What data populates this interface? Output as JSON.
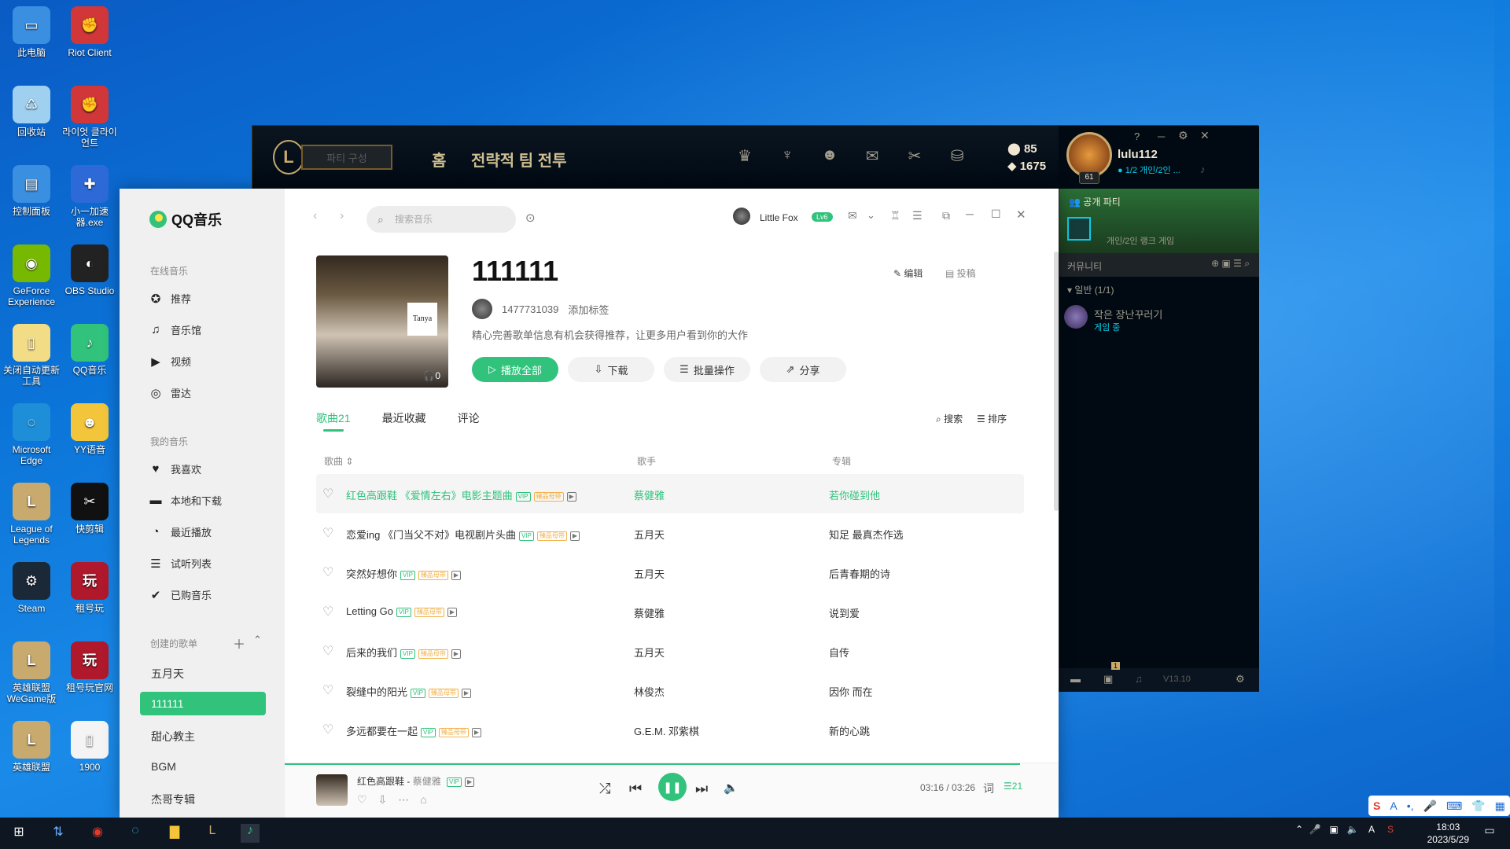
{
  "desktop": {
    "icons": [
      {
        "label": "此电脑",
        "color": "#3b8fe0",
        "glyph": "▭"
      },
      {
        "label": "Riot Client",
        "color": "#d13639",
        "glyph": "✊"
      },
      {
        "label": "回收站",
        "color": "#9fd0f0",
        "glyph": "♺"
      },
      {
        "label": "라이엇 클라이언트",
        "color": "#d13639",
        "glyph": "✊"
      },
      {
        "label": "控制面板",
        "color": "#3b8fe0",
        "glyph": "▤"
      },
      {
        "label": "小一加速器.exe",
        "color": "#2d6ad8",
        "glyph": "✚"
      },
      {
        "label": "GeForce Experience",
        "color": "#76b900",
        "glyph": "◉"
      },
      {
        "label": "OBS Studio",
        "color": "#222",
        "glyph": "◐"
      },
      {
        "label": "关闭自动更新工具",
        "color": "#f3dc86",
        "glyph": "▯"
      },
      {
        "label": "QQ音乐",
        "color": "#31c27c",
        "glyph": "♪"
      },
      {
        "label": "Microsoft Edge",
        "color": "#1e8ed8",
        "glyph": "◌"
      },
      {
        "label": "YY语音",
        "color": "#f3c53a",
        "glyph": "☻"
      },
      {
        "label": "League of Legends",
        "color": "#c8aa6e",
        "glyph": "L"
      },
      {
        "label": "快剪辑",
        "color": "#111",
        "glyph": "✂"
      },
      {
        "label": "Steam",
        "color": "#1b2838",
        "glyph": "⚙"
      },
      {
        "label": "租号玩",
        "color": "#b0182b",
        "glyph": "玩"
      },
      {
        "label": "英雄联盟WeGame版",
        "color": "#c8aa6e",
        "glyph": "L"
      },
      {
        "label": "租号玩官网",
        "color": "#b0182b",
        "glyph": "玩"
      },
      {
        "label": "英雄联盟",
        "color": "#c8aa6e",
        "glyph": "L"
      },
      {
        "label": "1900",
        "color": "#f4f4f4",
        "glyph": "▯"
      }
    ]
  },
  "lol": {
    "party_label": "파티 구성",
    "nav_home": "홈",
    "nav_tft": "전략적 팀 전투",
    "rp": "85",
    "be": "1675",
    "summoner": "lulu112",
    "status": "1/2 개인/2인 ...",
    "level": "61",
    "open_party": "공개 파티",
    "party_mode": "개인/2인 랭크 게임",
    "community": "커뮤니티",
    "group": "일반 (1/1)",
    "friend_name": "작은 장난꾸러기",
    "friend_status": "게임 중",
    "version": "V13.10",
    "badge": "1",
    "title_help": "?",
    "title_min": "─",
    "title_close": "✕"
  },
  "qq": {
    "app_name": "QQ音乐",
    "sections": {
      "online": "在线音乐",
      "mine": "我的音乐",
      "created": "创建的歌单"
    },
    "online_items": [
      {
        "label": "推荐",
        "icon": "✪"
      },
      {
        "label": "音乐馆",
        "icon": "♫"
      },
      {
        "label": "视频",
        "icon": "▶"
      },
      {
        "label": "雷达",
        "icon": "◎"
      }
    ],
    "my_items": [
      {
        "label": "我喜欢",
        "icon": "♥"
      },
      {
        "label": "本地和下载",
        "icon": "▬"
      },
      {
        "label": "最近播放",
        "icon": "◔"
      },
      {
        "label": "试听列表",
        "icon": "☰"
      },
      {
        "label": "已购音乐",
        "icon": "✔"
      }
    ],
    "playlists": [
      "五月天",
      "111111",
      "甜心教主",
      "BGM",
      "杰哥专辑"
    ],
    "search_placeholder": "搜索音乐",
    "user": "Little Fox",
    "vip": "Lv6",
    "playlist_title": "111111",
    "owner_id": "1477731039",
    "add_tag": "添加标签",
    "desc": "精心完善歌单信息有机会获得推荐，让更多用户看到你的大作",
    "cover_count": "0",
    "cover_tag": "Tanya",
    "edit": "编辑",
    "submit": "投稿",
    "btn_play": "播放全部",
    "btn_download": "下载",
    "btn_batch": "批量操作",
    "btn_share": "分享",
    "tabs": [
      "歌曲21",
      "最近收藏",
      "评论"
    ],
    "search_link": "搜索",
    "sort_link": "排序",
    "col_song": "歌曲 ⇕",
    "col_singer": "歌手",
    "col_album": "专辑",
    "tag_vip": "VIP",
    "tag_hq": "臻品母带",
    "tag_mv": "▶",
    "songs": [
      {
        "title": "红色高跟鞋 《爱情左右》电影主题曲",
        "singer": "蔡健雅",
        "album": "若你碰到他",
        "playing": true
      },
      {
        "title": "恋爱ing 《门当父不对》电视剧片头曲",
        "singer": "五月天",
        "album": "知足 最真杰作选",
        "playing": false
      },
      {
        "title": "突然好想你",
        "singer": "五月天",
        "album": "后青春期的诗",
        "playing": false
      },
      {
        "title": "Letting Go",
        "singer": "蔡健雅",
        "album": "说到爱",
        "playing": false
      },
      {
        "title": "后来的我们",
        "singer": "五月天",
        "album": "自传",
        "playing": false
      },
      {
        "title": "裂缝中的阳光",
        "singer": "林俊杰",
        "album": "因你 而在",
        "playing": false
      },
      {
        "title": "多远都要在一起",
        "singer": "G.E.M. 邓紫棋",
        "album": "新的心跳",
        "playing": false
      }
    ],
    "now_playing": "红色高跟鞋",
    "now_artist": "蔡健雅",
    "time": "03:16 / 03:26",
    "lyric": "词",
    "queue_count": "21",
    "progress": 0.95
  },
  "taskbar": {
    "time": "18:03",
    "date": "2023/5/29"
  },
  "ime": {
    "brand": "S",
    "lang": "A"
  }
}
